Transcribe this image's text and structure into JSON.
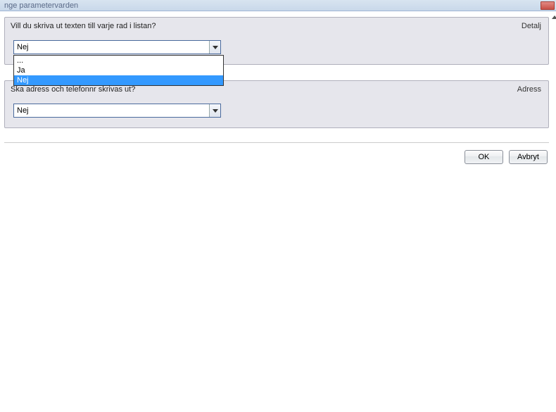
{
  "window": {
    "title": "nge parametervarden"
  },
  "panels": {
    "detalj": {
      "question": "Vill du skriva ut texten till varje rad i listan?",
      "rightLabel": "Detalj",
      "selected": "Nej",
      "options": [
        "...",
        "Ja",
        "Nej"
      ]
    },
    "adress": {
      "question": "Ska adress och telefonnr skrivas ut?",
      "rightLabel": "Adress",
      "selected": "Nej"
    }
  },
  "buttons": {
    "ok": "OK",
    "cancel": "Avbryt"
  }
}
